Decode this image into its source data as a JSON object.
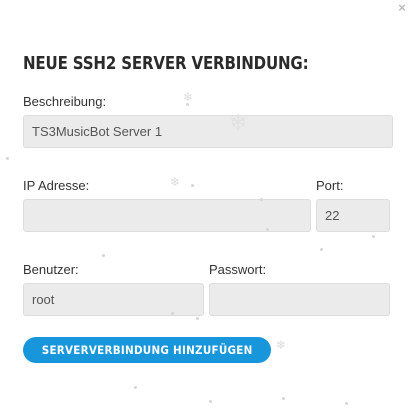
{
  "dialog": {
    "title": "NEUE SSH2 SERVER VERBINDUNG:",
    "close_glyph": "×"
  },
  "form": {
    "description": {
      "label": "Beschreibung:",
      "value": "TS3MusicBot Server 1"
    },
    "ip": {
      "label": "IP Adresse:",
      "value": ""
    },
    "port": {
      "label": "Port:",
      "value": "22"
    },
    "user": {
      "label": "Benutzer:",
      "value": "root"
    },
    "password": {
      "label": "Passwort:",
      "value": ""
    }
  },
  "actions": {
    "submit_label": "SERVERVERBINDUNG HINZUFÜGEN"
  },
  "colors": {
    "accent": "#1896dc",
    "field_bg": "#ebebeb",
    "title": "#2b2b2b"
  }
}
